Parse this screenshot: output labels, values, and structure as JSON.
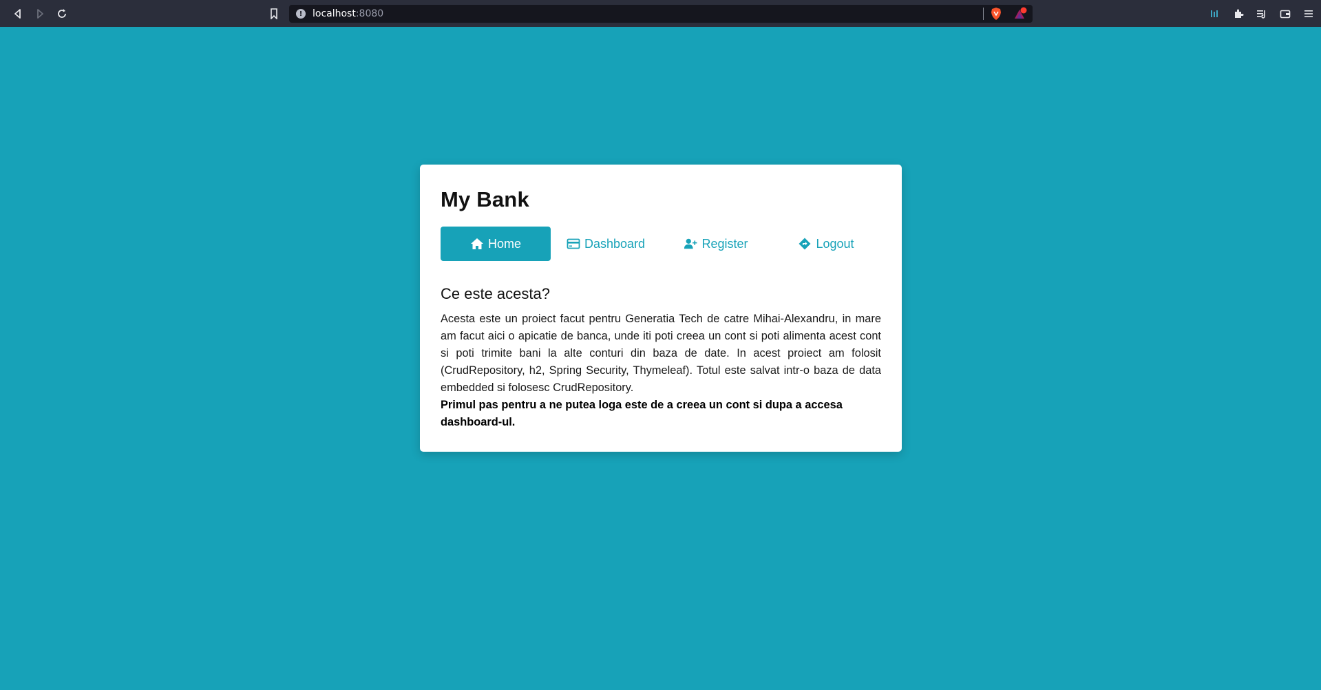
{
  "browser": {
    "url_host": "localhost",
    "url_port": ":8080"
  },
  "app": {
    "title": "My Bank",
    "tabs": [
      {
        "label": "Home",
        "icon": "home-icon",
        "active": true
      },
      {
        "label": "Dashboard",
        "icon": "credit-card-icon",
        "active": false
      },
      {
        "label": "Register",
        "icon": "user-plus-icon",
        "active": false
      },
      {
        "label": "Logout",
        "icon": "directions-icon",
        "active": false
      }
    ],
    "section_title": "Ce este acesta?",
    "description": "Acesta este un proiect facut pentru Generatia Tech de catre Mihai-Alexandru, in mare am facut aici o apicatie de banca, unde iti poti creea un cont si poti alimenta acest cont si poti trimite bani la alte conturi din baza de date. In acest proiect am folosit (CrudRepository, h2, Spring Security, Thymeleaf). Totul este salvat intr-o baza de data embedded si folosesc CrudRepository.",
    "note": "Primul pas pentru a ne putea loga este de a creea un cont si dupa a accesa dashboard-ul."
  },
  "colors": {
    "accent": "#17a2b8",
    "chrome": "#2b2e3b",
    "urlbar": "#15161e"
  }
}
